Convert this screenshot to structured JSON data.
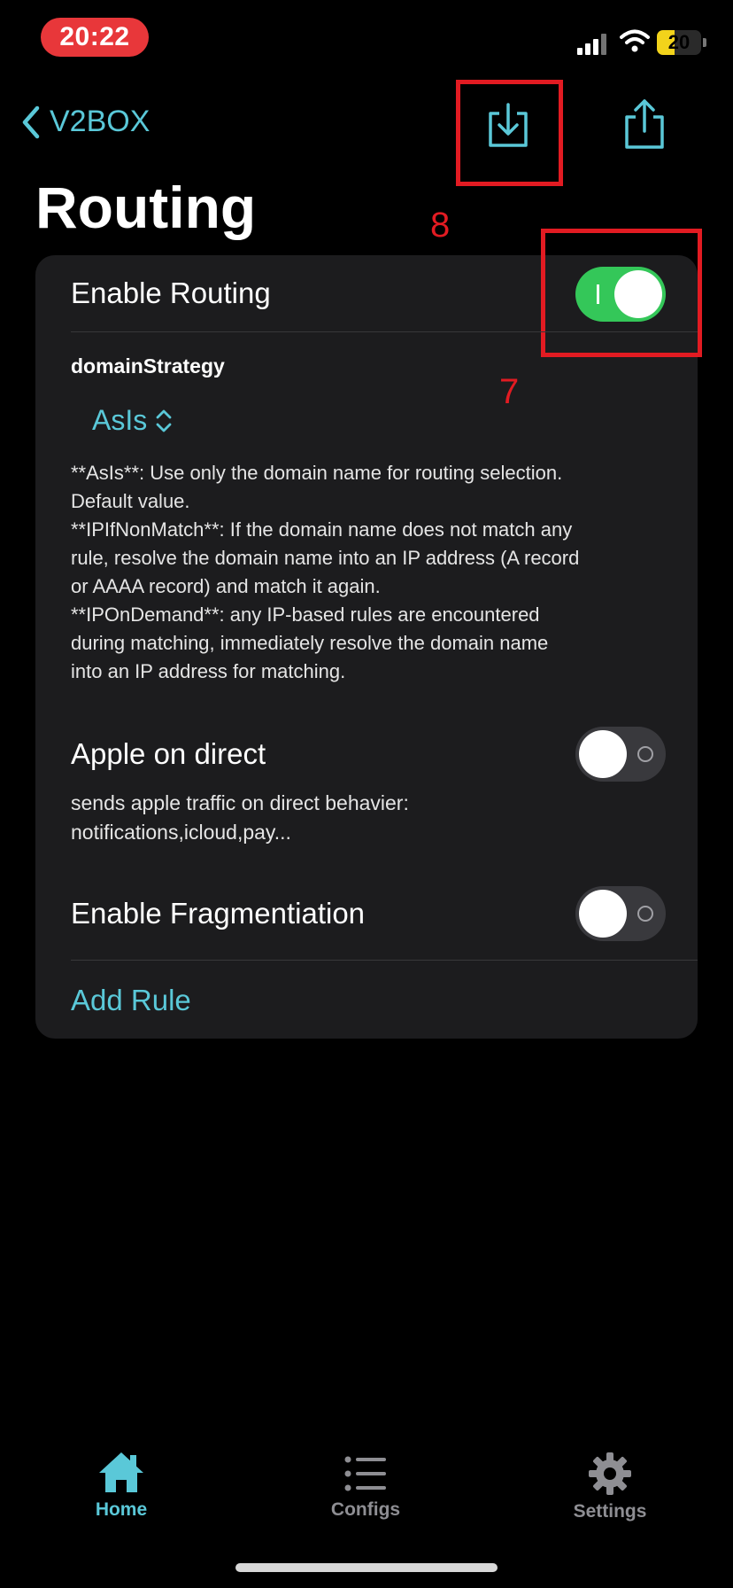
{
  "status_bar": {
    "time": "20:22",
    "battery": "20",
    "battery_level": 0.2
  },
  "nav": {
    "back_label": "V2BOX",
    "title": "Routing",
    "import_icon": "download-tray-icon",
    "share_icon": "share-icon"
  },
  "annotations": {
    "import_marker": "8",
    "toggle_marker": "7",
    "color": "#e21b22"
  },
  "routing": {
    "enable_label": "Enable Routing",
    "enable_on": true,
    "domain_strategy_label": "domainStrategy",
    "domain_strategy_value": "AsIs",
    "description": "**AsIs**: Use only the domain name for routing selection.\nDefault value.\n**IPIfNonMatch**: If the domain name does not match any\nrule, resolve the domain name into an IP address (A record\nor AAAA record) and match it again.\n**IPOnDemand**: any IP-based rules are encountered\nduring matching, immediately resolve the domain name\ninto an IP address for matching.",
    "apple_direct_label": "Apple on direct",
    "apple_direct_on": false,
    "apple_direct_desc": "sends apple traffic on direct behavier:\nnotifications,icloud,pay...",
    "fragmentation_label": "Enable Fragmentiation",
    "fragmentation_on": false,
    "add_rule_label": "Add Rule"
  },
  "tabbar": {
    "items": [
      {
        "label": "Home",
        "icon": "home-icon",
        "active": true
      },
      {
        "label": "Configs",
        "icon": "list-icon",
        "active": false
      },
      {
        "label": "Settings",
        "icon": "gear-icon",
        "active": false
      }
    ]
  },
  "colors": {
    "accent": "#5ac8d8",
    "toggle_on": "#34c759",
    "card": "#1c1c1e"
  }
}
